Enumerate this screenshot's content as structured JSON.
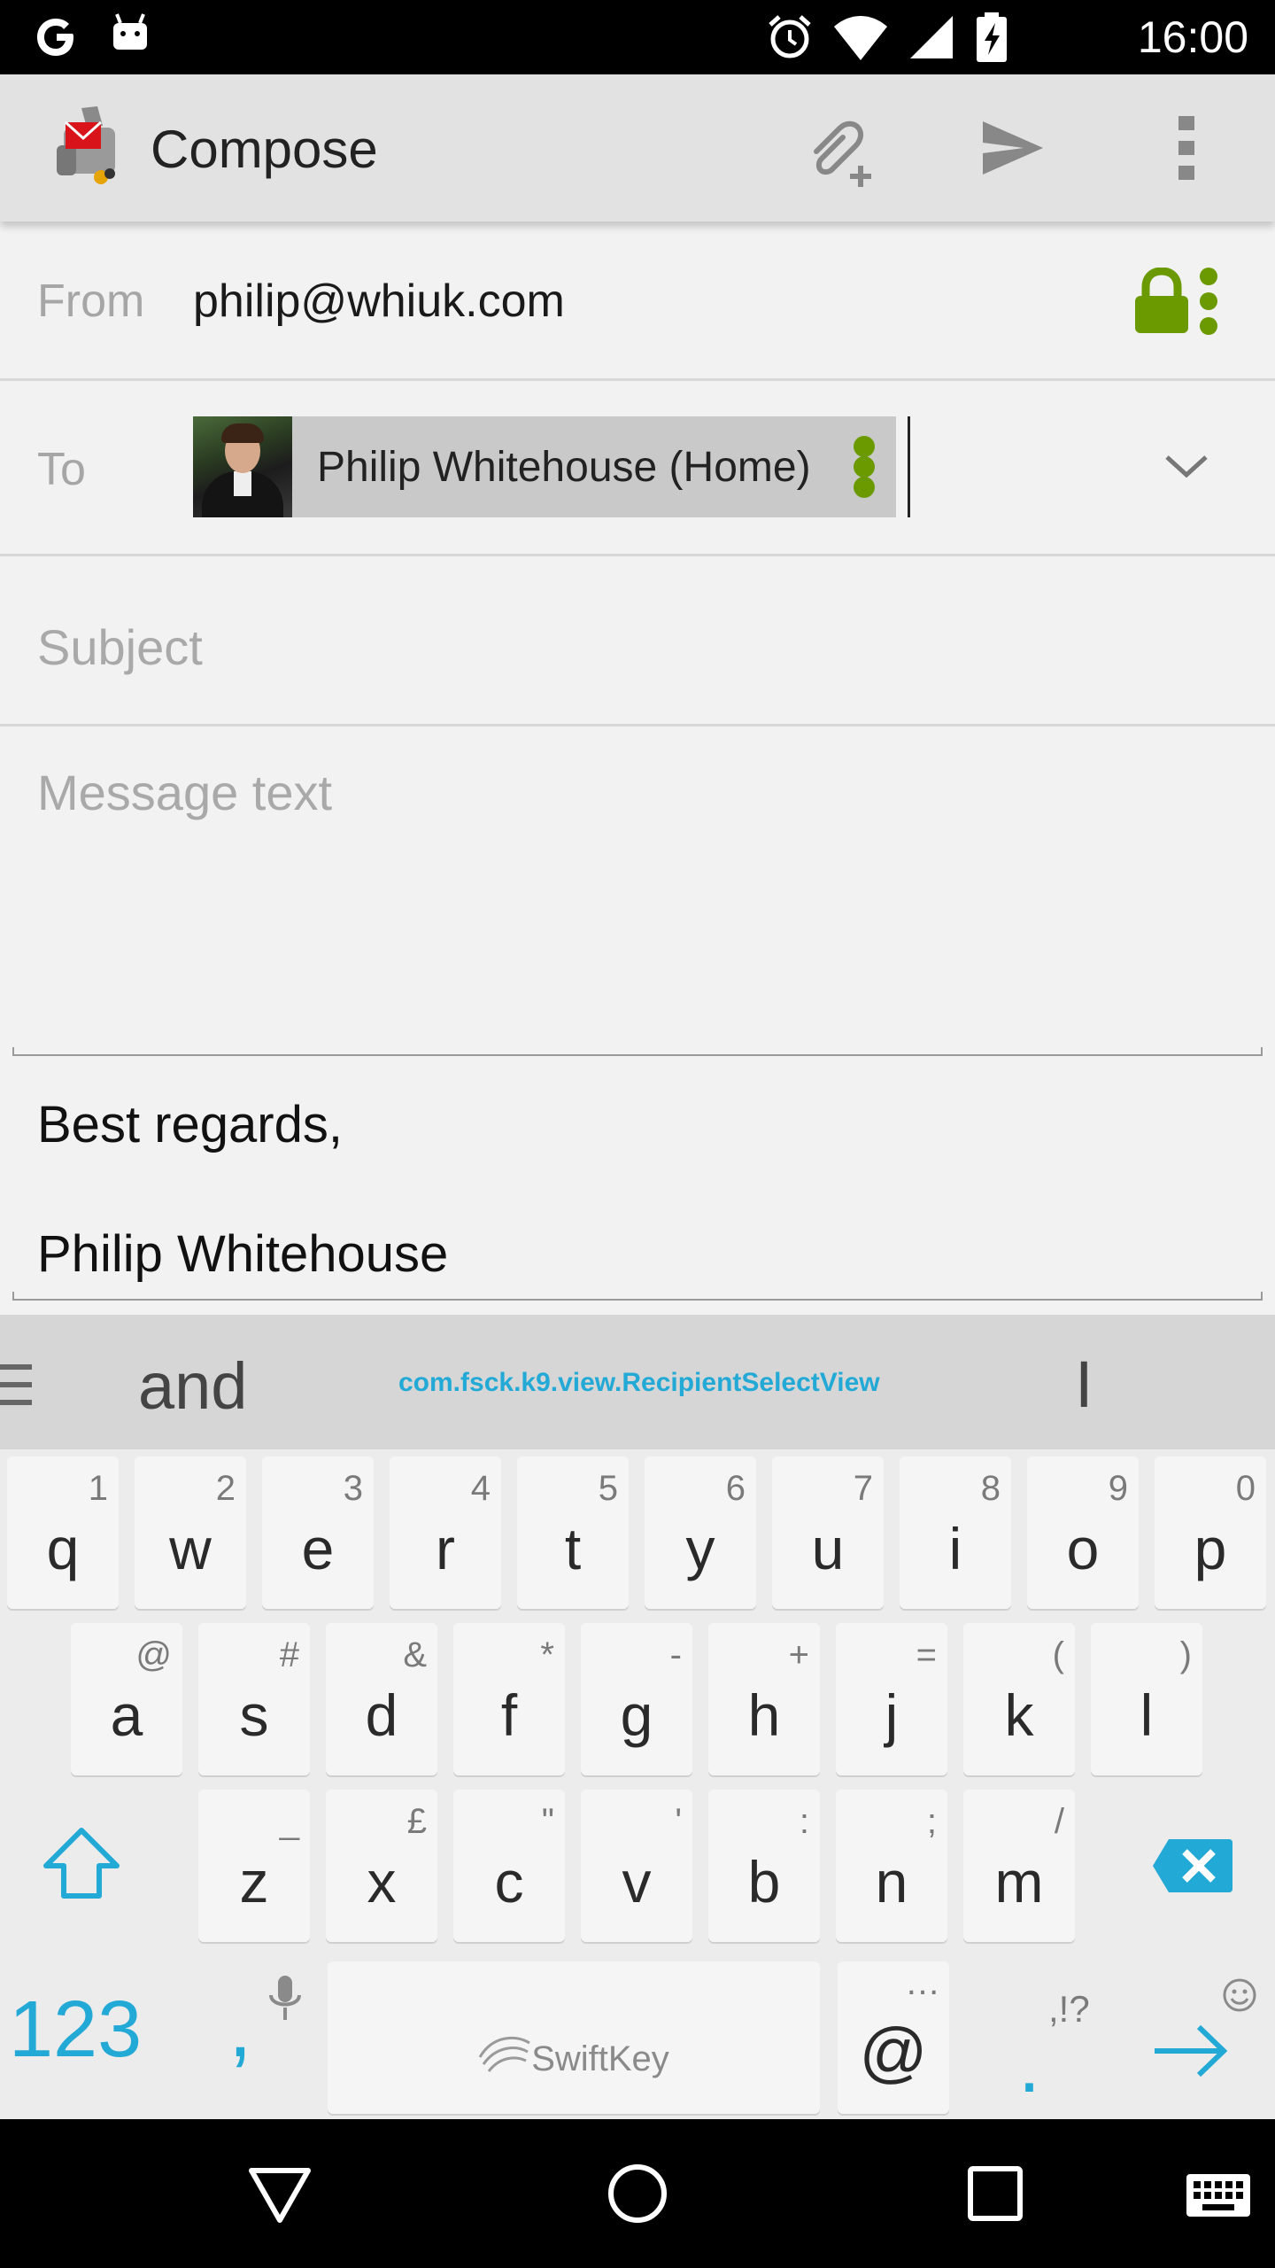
{
  "status_bar": {
    "time": "16:00",
    "icons": [
      "google-icon",
      "android-icon",
      "alarm-icon",
      "wifi-icon",
      "signal-icon",
      "battery-charging-icon"
    ]
  },
  "action_bar": {
    "title": "Compose",
    "actions": [
      "attach-icon",
      "send-icon",
      "overflow-menu-icon"
    ]
  },
  "compose": {
    "from_label": "From",
    "from_value": "philip@whiuk.com",
    "to_label": "To",
    "recipient_name": "Philip Whitehouse (Home)",
    "subject_placeholder": "Subject",
    "message_placeholder": "Message text",
    "signature_line1": "Best regards,",
    "signature_line2": "Philip Whitehouse"
  },
  "keyboard": {
    "suggestions": {
      "left": "and",
      "center": "com.fsck.k9.view.RecipientSelectView",
      "right": "I"
    },
    "row1": [
      {
        "key": "q",
        "sec": "1"
      },
      {
        "key": "w",
        "sec": "2"
      },
      {
        "key": "e",
        "sec": "3"
      },
      {
        "key": "r",
        "sec": "4"
      },
      {
        "key": "t",
        "sec": "5"
      },
      {
        "key": "y",
        "sec": "6"
      },
      {
        "key": "u",
        "sec": "7"
      },
      {
        "key": "i",
        "sec": "8"
      },
      {
        "key": "o",
        "sec": "9"
      },
      {
        "key": "p",
        "sec": "0"
      }
    ],
    "row2": [
      {
        "key": "a",
        "sec": "@"
      },
      {
        "key": "s",
        "sec": "#"
      },
      {
        "key": "d",
        "sec": "&"
      },
      {
        "key": "f",
        "sec": "*"
      },
      {
        "key": "g",
        "sec": "-"
      },
      {
        "key": "h",
        "sec": "+"
      },
      {
        "key": "j",
        "sec": "="
      },
      {
        "key": "k",
        "sec": "("
      },
      {
        "key": "l",
        "sec": ")"
      }
    ],
    "row3": [
      {
        "key": "z",
        "sec": "_"
      },
      {
        "key": "x",
        "sec": "£"
      },
      {
        "key": "c",
        "sec": "\""
      },
      {
        "key": "v",
        "sec": "'"
      },
      {
        "key": "b",
        "sec": ":"
      },
      {
        "key": "n",
        "sec": ";"
      },
      {
        "key": "m",
        "sec": "/"
      }
    ],
    "num_label": "123",
    "comma_label": ",",
    "space_label": "SwiftKey",
    "at_label": "@",
    "at_sec": "…",
    "period_label": ".",
    "period_sec": ",!?"
  },
  "colors": {
    "accent_blue": "#23a9d6",
    "crypto_green": "#6a9a00"
  }
}
